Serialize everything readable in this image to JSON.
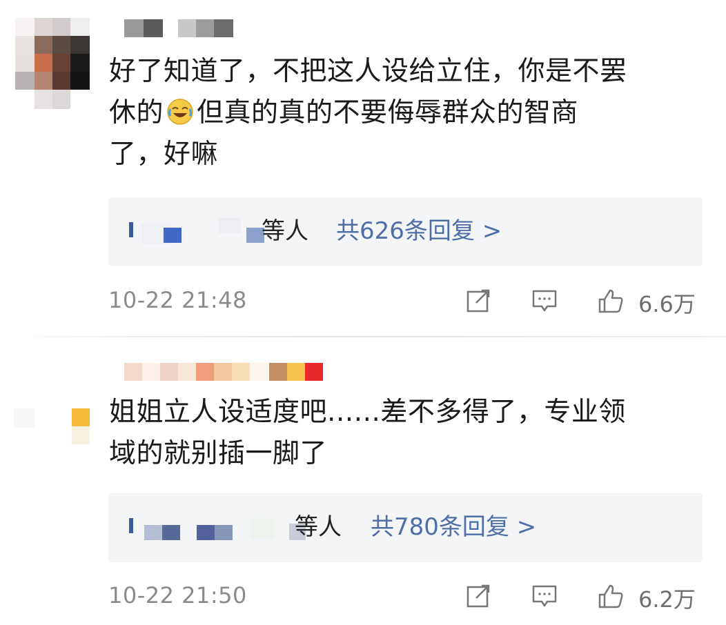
{
  "comments": [
    {
      "text_lines": [
        "好了知道了，不把这人设给立住，你是不罢",
        "休的",
        "但真的真的不要侮辱群众的智商",
        "了，好嘛"
      ],
      "emoji": "laugh-cry-emoji",
      "replies": {
        "names_suffix": "等人",
        "count_text": "共626条回复 >"
      },
      "time": "10-22 21:48",
      "likes": "6.6万",
      "icons": [
        "share-icon",
        "comment-icon",
        "like-icon"
      ]
    },
    {
      "text_lines": [
        "姐姐立人设适度吧......差不多得了，专业领",
        "域的就别插一脚了"
      ],
      "replies": {
        "names_suffix": "等人",
        "count_text": "共780条回复 >"
      },
      "time": "10-22 21:50",
      "likes": "6.2万",
      "icons": [
        "share-icon",
        "comment-icon",
        "like-icon"
      ]
    }
  ],
  "colors": {
    "link": "#4e6ea6",
    "meta": "#8a8a8a",
    "reply_bg": "#f4f5f6"
  }
}
